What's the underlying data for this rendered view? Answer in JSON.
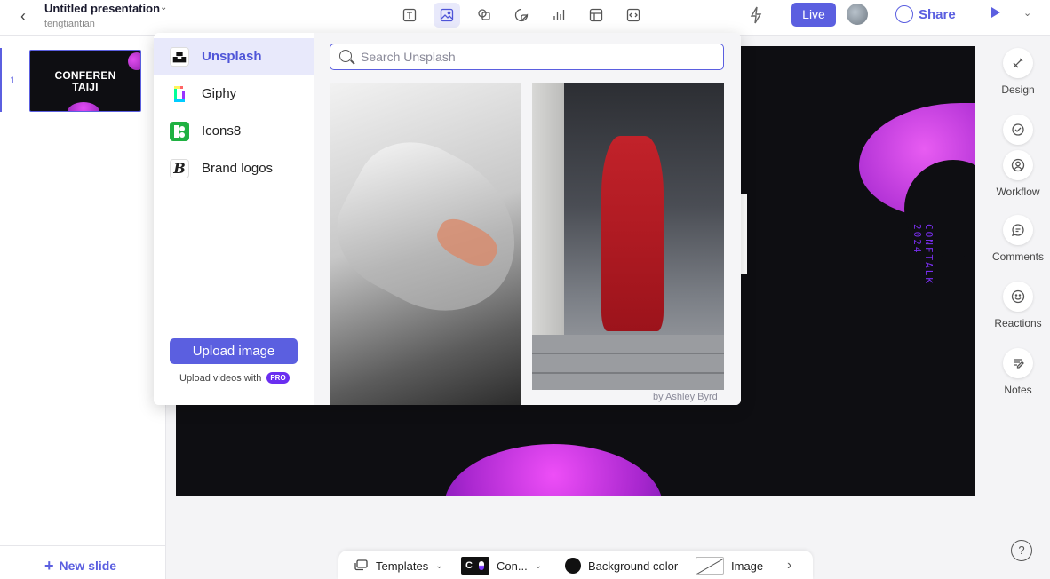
{
  "header": {
    "title": "Untitled presentation",
    "owner": "tengtiantian",
    "live_label": "Live",
    "share_label": "Share"
  },
  "slides_panel": {
    "slide_number": "1",
    "thumb_title_line1": "CONFEREN",
    "thumb_title_line2": "TAIJI",
    "new_slide_label": "New slide"
  },
  "canvas": {
    "vertical_text": "CONFTALK 2024"
  },
  "right_sidebar": {
    "design": "Design",
    "workflow": "Workflow",
    "comments": "Comments",
    "reactions": "Reactions",
    "notes": "Notes"
  },
  "bottombar": {
    "templates": "Templates",
    "theme": "Con...",
    "background": "Background color",
    "image": "Image"
  },
  "media_popover": {
    "sources": [
      {
        "label": "Unsplash",
        "active": true
      },
      {
        "label": "Giphy",
        "active": false
      },
      {
        "label": "Icons8",
        "active": false
      },
      {
        "label": "Brand logos",
        "active": false
      }
    ],
    "search_placeholder": "Search Unsplash",
    "upload_label": "Upload image",
    "upload_videos_text": "Upload videos with",
    "pro_badge": "PRO",
    "credit_prefix": "by",
    "credit_author": "Ashley Byrd"
  },
  "colors": {
    "accent": "#5b5fe0",
    "canvas_bg": "#0e0e12",
    "magenta": "#d63ef0"
  }
}
